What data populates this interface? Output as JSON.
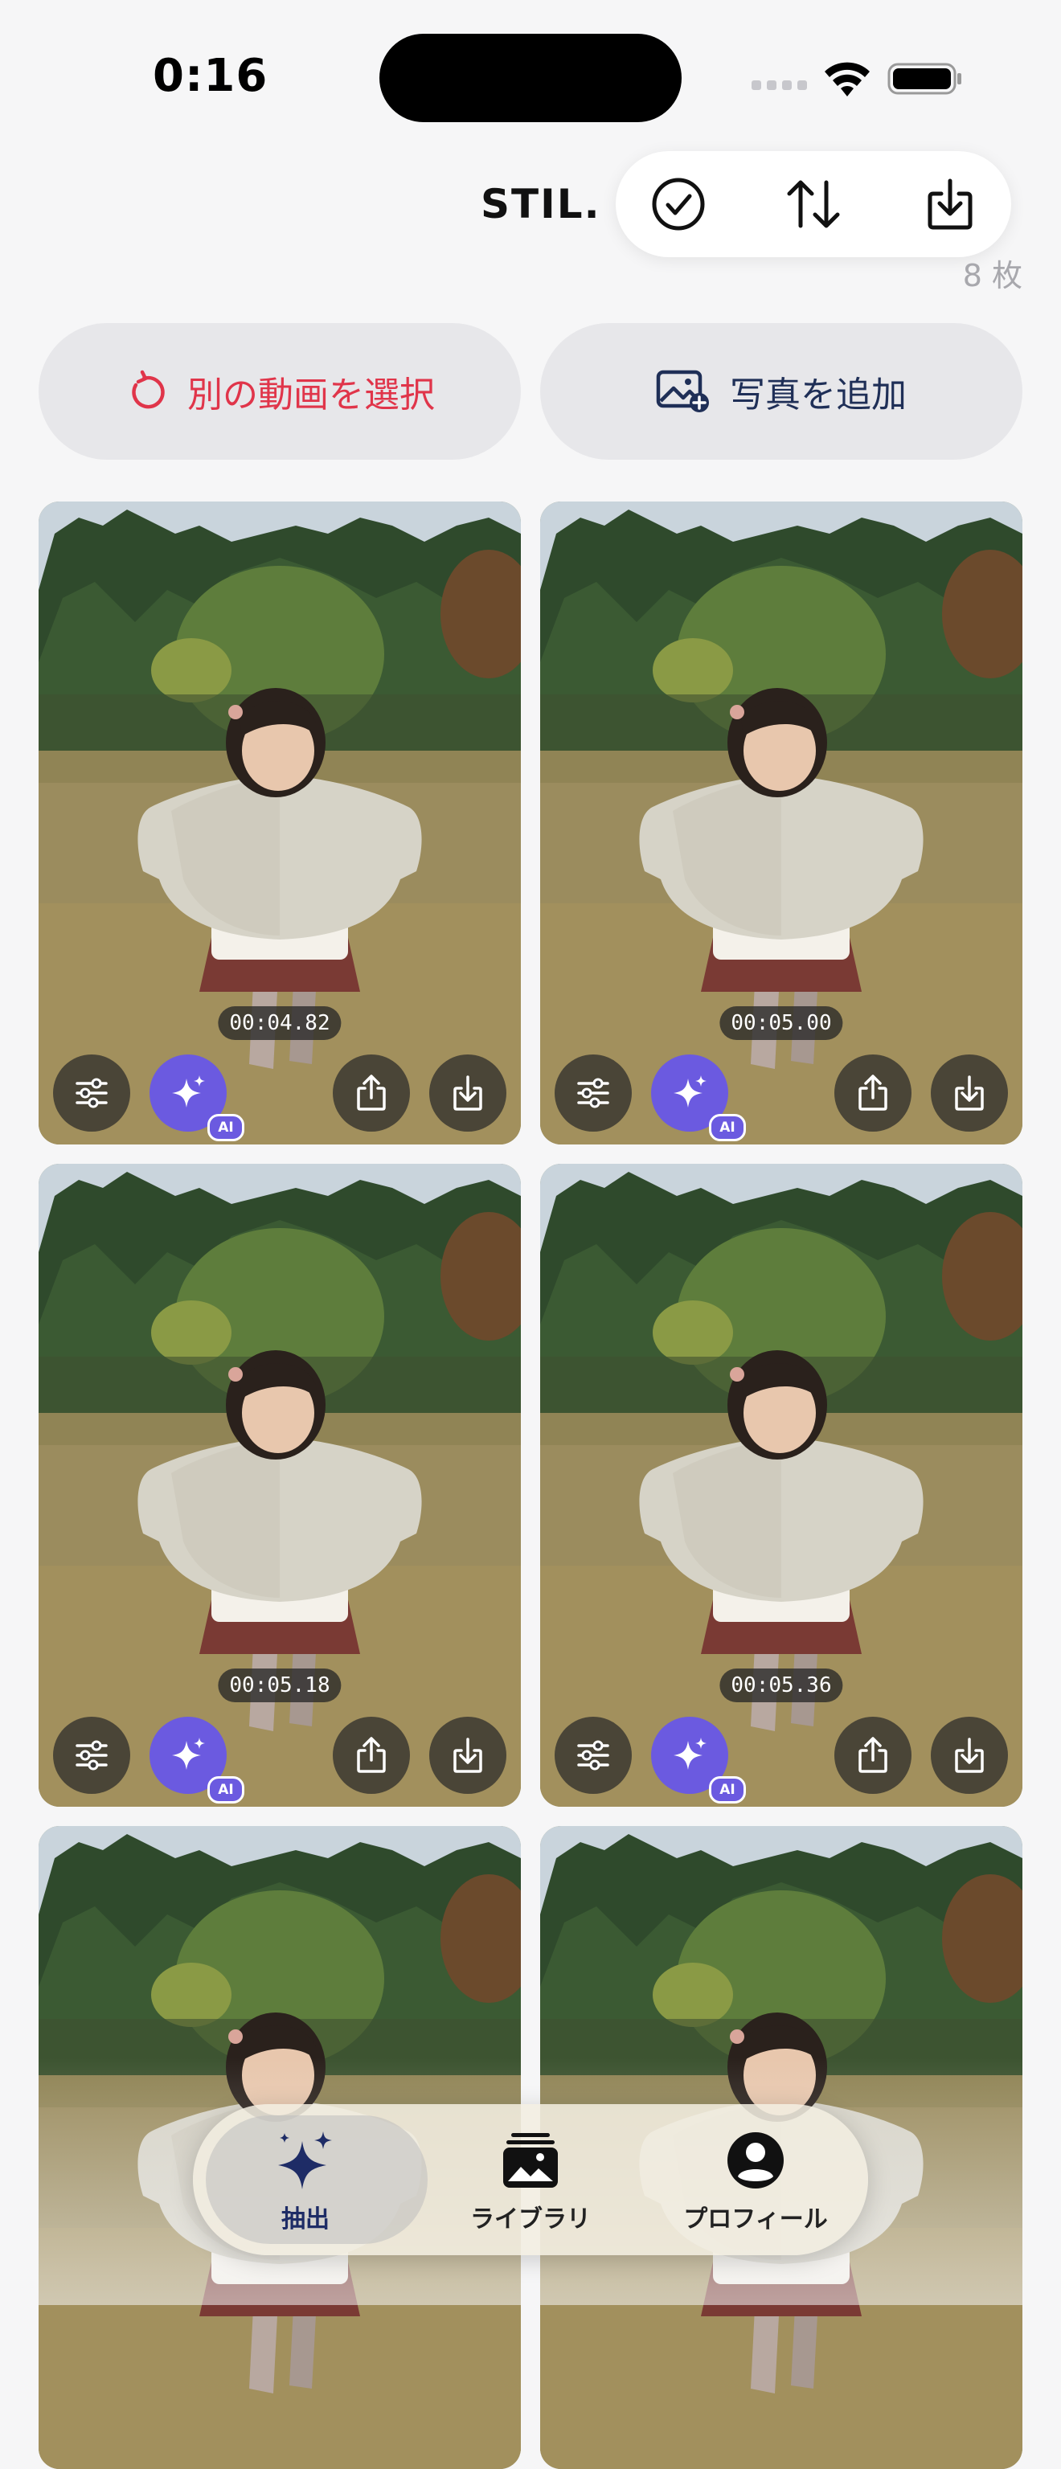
{
  "status_bar": {
    "time": "0:16"
  },
  "header": {
    "title": "STIL.",
    "count": "8 枚"
  },
  "actions": {
    "reselect_label": "別の動画を選択",
    "add_photo_label": "写真を追加"
  },
  "frames": [
    {
      "timecode": "00:04.82",
      "ai_badge": "AI"
    },
    {
      "timecode": "00:05.00",
      "ai_badge": "AI"
    },
    {
      "timecode": "00:05.18",
      "ai_badge": "AI"
    },
    {
      "timecode": "00:05.36",
      "ai_badge": "AI"
    },
    {
      "timecode": "",
      "ai_badge": ""
    },
    {
      "timecode": "",
      "ai_badge": ""
    }
  ],
  "tabs": [
    {
      "label": "抽出",
      "icon": "sparkles-icon"
    },
    {
      "label": "ライブラリ",
      "icon": "photo-library-icon"
    },
    {
      "label": "プロフィール",
      "icon": "person-circle-icon"
    }
  ],
  "colors": {
    "accent": "#6b5ae0",
    "danger": "#e0354a",
    "navy": "#1f2f57"
  }
}
